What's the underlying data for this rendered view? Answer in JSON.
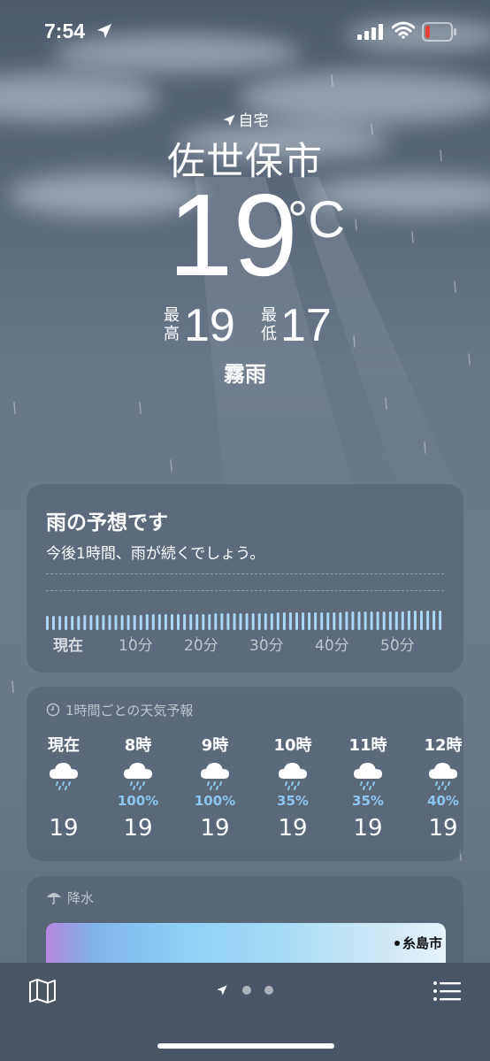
{
  "status_bar": {
    "time": "7:54"
  },
  "header": {
    "home_label": "自宅",
    "city": "佐世保市",
    "temperature": "19",
    "unit": "°C",
    "high_label_1": "最",
    "high_label_2": "高",
    "high": "19",
    "low_label_1": "最",
    "low_label_2": "低",
    "low": "17",
    "condition": "霧雨"
  },
  "rain_card": {
    "title": "雨の予想です",
    "subtitle": "今後1時間、雨が続くでしょう。",
    "ticks": [
      "現在",
      "10分",
      "20分",
      "30分",
      "40分",
      "50分"
    ]
  },
  "hourly_card": {
    "header": "1時間ごとの天気予報",
    "hours": [
      {
        "label": "現在",
        "pop": "",
        "temp": "19"
      },
      {
        "label": "8時",
        "pop": "100%",
        "temp": "19"
      },
      {
        "label": "9時",
        "pop": "100%",
        "temp": "19"
      },
      {
        "label": "10時",
        "pop": "35%",
        "temp": "19"
      },
      {
        "label": "11時",
        "pop": "35%",
        "temp": "19"
      },
      {
        "label": "12時",
        "pop": "40%",
        "temp": "19"
      }
    ]
  },
  "precip_card": {
    "header": "降水",
    "map_city": "糸島市"
  },
  "icons": {
    "location": "location-arrow-icon",
    "clock": "clock-icon",
    "umbrella": "umbrella-icon",
    "rain": "cloud-rain-icon",
    "map": "map-icon",
    "list": "list-icon"
  },
  "colors": {
    "precip_percent": "#8ac6f0",
    "battery_low": "#e8413a"
  }
}
